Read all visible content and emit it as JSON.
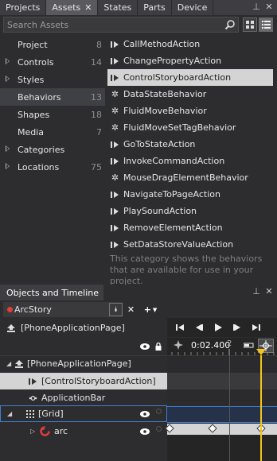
{
  "tabs": [
    {
      "label": "Projects"
    },
    {
      "label": "Assets"
    },
    {
      "label": "States"
    },
    {
      "label": "Parts"
    },
    {
      "label": "Device"
    }
  ],
  "search": {
    "placeholder": "Search Assets",
    "value": ""
  },
  "categories": [
    {
      "label": "Project",
      "count": "8",
      "expandable": false
    },
    {
      "label": "Controls",
      "count": "14",
      "expandable": true
    },
    {
      "label": "Styles",
      "count": "",
      "expandable": true
    },
    {
      "label": "Behaviors",
      "count": "13",
      "expandable": false
    },
    {
      "label": "Shapes",
      "count": "18",
      "expandable": false
    },
    {
      "label": "Media",
      "count": "7",
      "expandable": false
    },
    {
      "label": "Categories",
      "count": "",
      "expandable": true
    },
    {
      "label": "Locations",
      "count": "75",
      "expandable": true
    }
  ],
  "behaviors": [
    {
      "label": "CallMethodAction",
      "icon": "action-icon"
    },
    {
      "label": "ChangePropertyAction",
      "icon": "action-icon"
    },
    {
      "label": "ControlStoryboardAction",
      "icon": "action-icon"
    },
    {
      "label": "DataStateBehavior",
      "icon": "gear-icon"
    },
    {
      "label": "FluidMoveBehavior",
      "icon": "gear-icon"
    },
    {
      "label": "FluidMoveSetTagBehavior",
      "icon": "gear-icon"
    },
    {
      "label": "GoToStateAction",
      "icon": "action-icon"
    },
    {
      "label": "InvokeCommandAction",
      "icon": "action-icon"
    },
    {
      "label": "MouseDragElementBehavior",
      "icon": "gear-icon"
    },
    {
      "label": "NavigateToPageAction",
      "icon": "action-icon"
    },
    {
      "label": "PlaySoundAction",
      "icon": "action-icon"
    },
    {
      "label": "RemoveElementAction",
      "icon": "action-icon"
    },
    {
      "label": "SetDataStoreValueAction",
      "icon": "action-icon"
    }
  ],
  "behaviors_description": "This category shows the behaviors that are available for use in your project.",
  "objects_timeline": {
    "title": "Objects and Timeline",
    "storyboard": "ArcStory",
    "scope": "[PhoneApplicationPage]",
    "timecode": "0:02.400",
    "ruler_label": "2",
    "tree": [
      {
        "label": "[PhoneApplicationPage]",
        "level": 0
      },
      {
        "label": "[ControlStoryboardAction]",
        "level": 1
      },
      {
        "label": "ApplicationBar",
        "level": 1
      },
      {
        "label": "[Grid]",
        "level": 1
      },
      {
        "label": "arc",
        "level": 2
      }
    ]
  },
  "colors": {
    "accent": "#3f7fd0",
    "keyframe_track": "#d4d4d4",
    "playhead": "#f5c518",
    "record": "#e03c3c"
  }
}
